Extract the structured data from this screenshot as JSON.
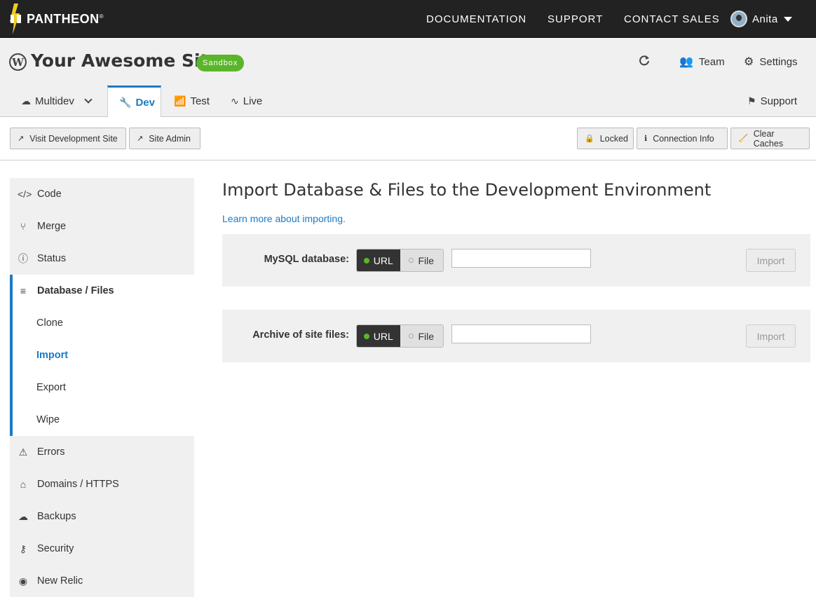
{
  "brand": {
    "name": "PANTHEON",
    "mark": "®"
  },
  "topnav": {
    "documentation": "DOCUMENTATION",
    "support": "SUPPORT",
    "contact_sales": "CONTACT SALES",
    "user": "Anita"
  },
  "site": {
    "name": "Your Awesome Site",
    "plan_badge": "Sandbox"
  },
  "header_actions": {
    "team": "Team",
    "settings": "Settings",
    "support": "Support"
  },
  "env_tabs": {
    "multidev": "Multidev",
    "dev": "Dev",
    "test": "Test",
    "live": "Live",
    "active": "Dev"
  },
  "toolbar": {
    "visit_site": "Visit Development Site",
    "site_admin": "Site Admin",
    "locked": "Locked",
    "connection_info": "Connection Info",
    "clear_caches": "Clear Caches"
  },
  "sidebar": {
    "code": "Code",
    "merge": "Merge",
    "status": "Status",
    "database_files": "Database / Files",
    "clone": "Clone",
    "import": "Import",
    "export": "Export",
    "wipe": "Wipe",
    "errors": "Errors",
    "domains": "Domains / HTTPS",
    "backups": "Backups",
    "security": "Security",
    "new_relic": "New Relic",
    "active": "Import"
  },
  "main": {
    "title": "Import Database & Files to the Development Environment",
    "learn_more": "Learn more about importing.",
    "mysql": {
      "label": "MySQL database:",
      "url": "URL",
      "file": "File",
      "selected": "URL",
      "value": "",
      "button": "Import"
    },
    "archive": {
      "label": "Archive of site files:",
      "url": "URL",
      "file": "File",
      "selected": "URL",
      "value": "",
      "button": "Import"
    }
  },
  "colors": {
    "accent": "#1a7bc6",
    "badge_green": "#5ab52a",
    "topbar": "#222222"
  }
}
